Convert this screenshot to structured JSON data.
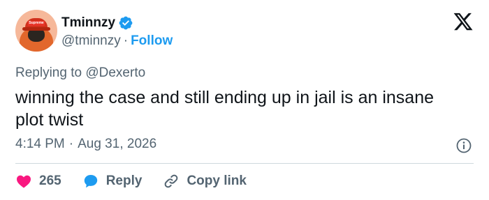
{
  "author": {
    "name": "Tminnzy",
    "handle": "@tminnzy",
    "separator": "·",
    "follow_label": "Follow",
    "avatar_cap_text": "Supreme"
  },
  "reply_context": {
    "prefix": "Replying to",
    "mention": "@Dexerto"
  },
  "tweet": {
    "text": "winning the case and still ending up in jail is an insane plot twist"
  },
  "meta": {
    "time": "4:14 PM",
    "separator": "·",
    "date": "Aug 31, 2026"
  },
  "actions": {
    "like_count": "265",
    "reply_label": "Reply",
    "copy_link_label": "Copy link"
  },
  "colors": {
    "accent": "#1d9bf0",
    "like": "#f91880",
    "text": "#0f1419",
    "muted": "#536471"
  },
  "icons": [
    "verified-badge-icon",
    "x-logo-icon",
    "info-icon",
    "heart-icon",
    "reply-bubble-icon",
    "link-icon"
  ]
}
